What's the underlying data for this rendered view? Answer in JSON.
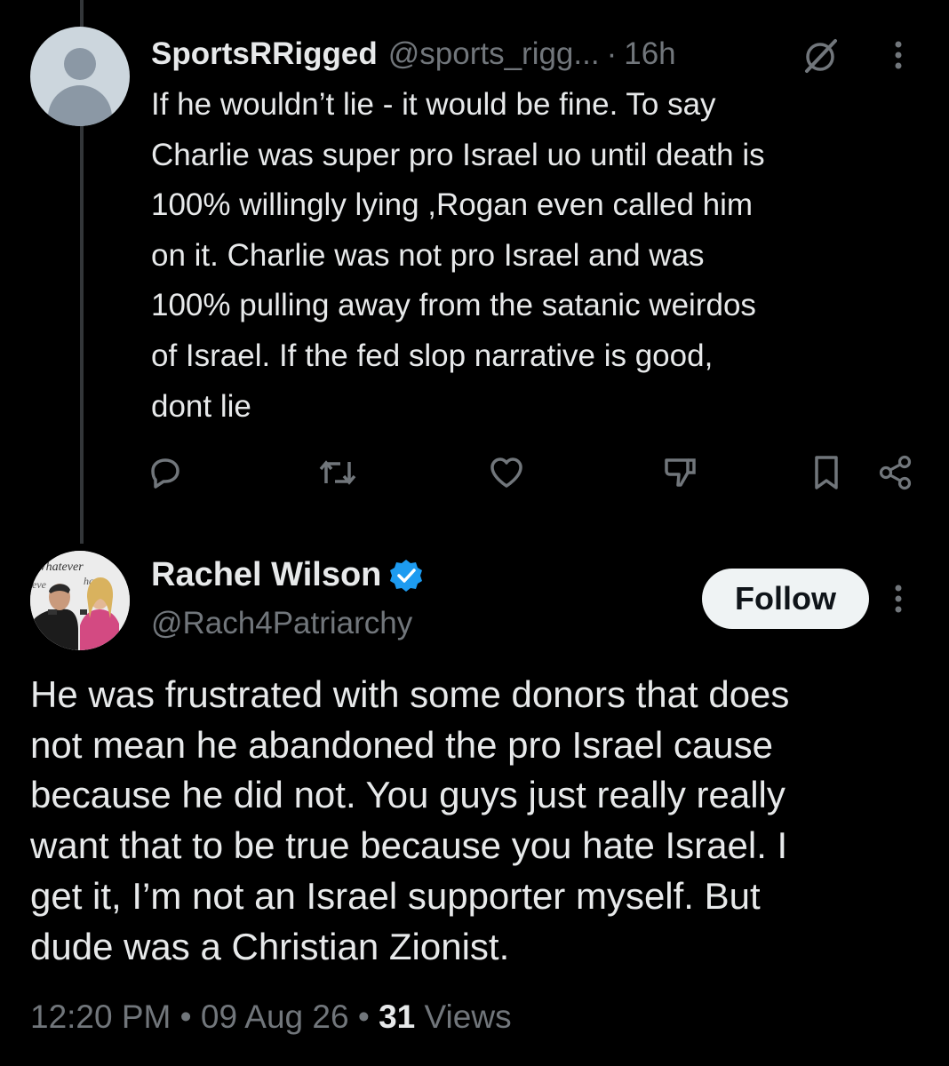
{
  "reply": {
    "display_name": "SportsRRigged",
    "handle": "@sports_rigg...",
    "separator": "·",
    "time": "16h",
    "text_lines": [
      "If he wouldn’t lie - it would be fine.  To say",
      "Charlie was super pro Israel uo until death is",
      "100% willingly lying ,Rogan even called him",
      "on it. Charlie was not pro Israel and was",
      "100% pulling away from the satanic weirdos",
      "of Israel.  If the fed slop narrative is good,",
      "dont lie"
    ],
    "actions": [
      "reply-icon",
      "repost-icon",
      "like-icon",
      "dislike-icon",
      "bookmark-icon",
      "share-icon"
    ]
  },
  "tweet": {
    "display_name": "Rachel Wilson",
    "handle": "@Rach4Patriarchy",
    "follow_label": "Follow",
    "text_lines": [
      "He was frustrated with some donors that does",
      "not mean he abandoned the pro Israel cause",
      "because he did not. You guys just really really",
      "want that to be true because you hate Israel. I",
      "get it, I’m not an Israel supporter myself. But",
      "dude was a Christian Zionist."
    ],
    "time": "12:20 PM",
    "separator": "•",
    "date": "09 Aug 26",
    "views_count": "31",
    "views_label": "Views",
    "avatar_text": "Whatever"
  },
  "colors": {
    "background": "#000000",
    "text_primary": "#e7e9ea",
    "text_secondary": "#71767b",
    "verified_blue": "#1d9bf0",
    "follow_bg": "#eff3f4",
    "thread_line": "#333639"
  }
}
